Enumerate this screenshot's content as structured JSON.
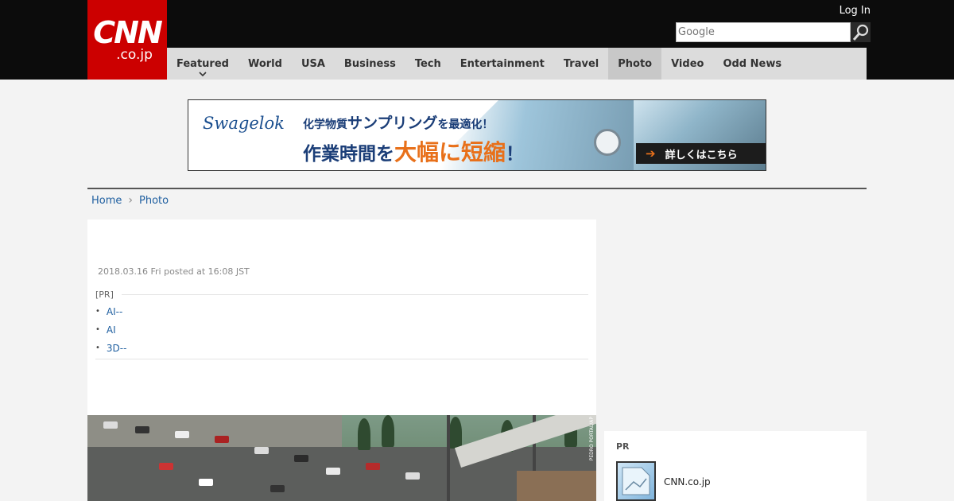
{
  "header": {
    "logo_main": "CNN",
    "logo_sub": ".co.jp",
    "login_label": "Log In",
    "search_placeholder": "Google"
  },
  "nav": {
    "items": [
      "Featured",
      "World",
      "USA",
      "Business",
      "Tech",
      "Entertainment",
      "Travel",
      "Photo",
      "Video",
      "Odd News"
    ],
    "active": "Photo"
  },
  "ad": {
    "brand": "Swagelok",
    "line1_prefix": "化学物質",
    "line1_big": "サンプリング",
    "line1_suffix": "を最適化！",
    "line2_prefix": "作業時間を",
    "line2_orange": "大幅に短縮",
    "line2_suffix": "！",
    "cta_arrow": "➔",
    "cta_label": "詳しくはこちら"
  },
  "breadcrumb": {
    "home": "Home",
    "separator": "›",
    "current": "Photo"
  },
  "article": {
    "posted": "2018.03.16 Fri posted at 16:08 JST",
    "pr_label": "[PR]",
    "pr_links": [
      "AI--",
      "AI",
      "3D--"
    ],
    "photo_credit": "PEDRO PORTAL/AP"
  },
  "sidebar": {
    "pr_title": "PR",
    "pr_item_text": "CNN.co.jp"
  },
  "colors": {
    "brand_red": "#cc0000",
    "link_blue": "#1f5fa0",
    "accent_orange": "#e8701a"
  }
}
